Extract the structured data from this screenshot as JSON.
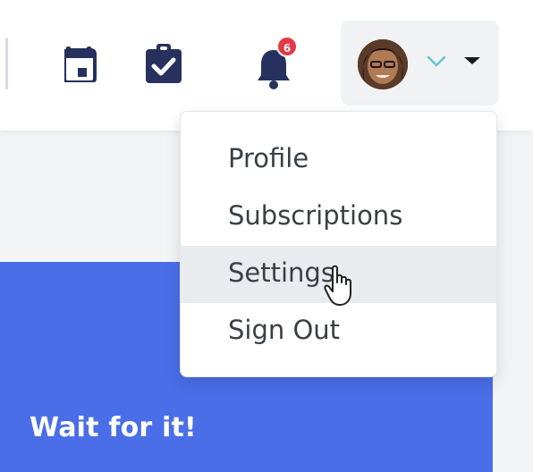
{
  "header": {
    "notifications": {
      "icon": "bell-icon",
      "count": "6"
    },
    "user": {
      "chevron_icon": "chevron-down-icon",
      "caret_icon": "caret-down-icon"
    }
  },
  "dropdown": {
    "items": [
      {
        "label": "Profile"
      },
      {
        "label": "Subscriptions"
      },
      {
        "label": "Settings",
        "active": true
      },
      {
        "label": "Sign Out"
      }
    ]
  },
  "hero": {
    "title": "Wait for it!"
  },
  "colors": {
    "icon": "#26315e",
    "badge": "#e53945",
    "hero": "#4a6ee8",
    "chevron": "#5ec6d6"
  }
}
